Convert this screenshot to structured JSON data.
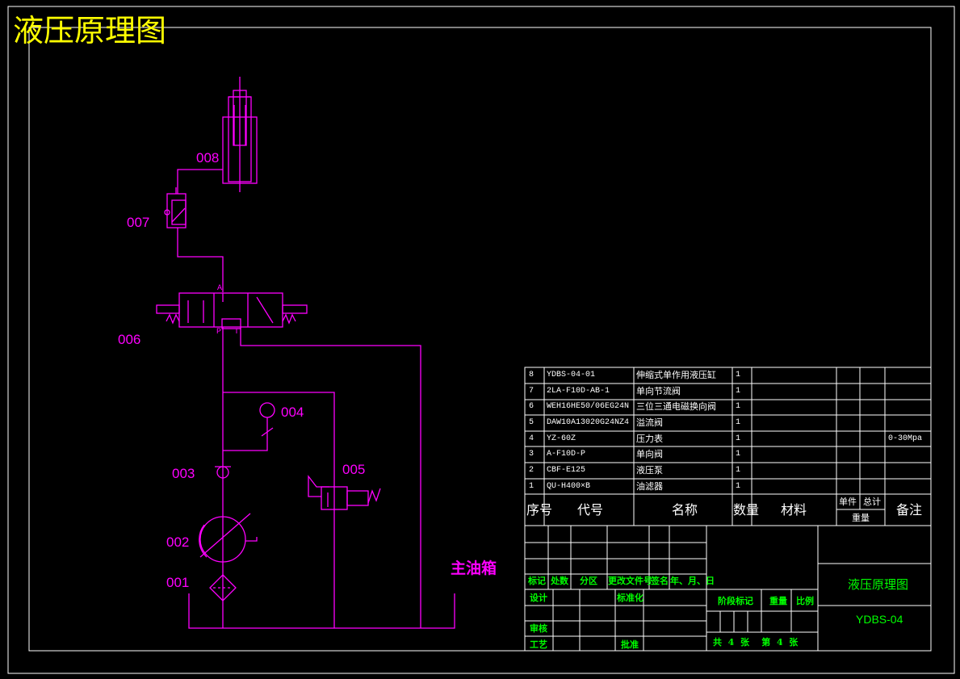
{
  "title": "液压原理图",
  "components": {
    "c001": "001",
    "c002": "002",
    "c003": "003",
    "c004": "004",
    "c005": "005",
    "c006": "006",
    "c007": "007",
    "c008": "008"
  },
  "tank_label": "主油箱",
  "valve_ports": {
    "a": "A",
    "p": "P",
    "t": "T"
  },
  "colors": {
    "frame": "#ffffff",
    "circuit": "#ff00ff",
    "title": "#ffff00",
    "titleblock_text": "#00ff00"
  },
  "parts_list": {
    "rows": [
      {
        "no": "8",
        "code": "YDBS-04-01",
        "name": "伸缩式单作用液压缸",
        "qty": "1",
        "note": ""
      },
      {
        "no": "7",
        "code": "2LA-F10D-AB-1",
        "name": "单向节流阀",
        "qty": "1",
        "note": ""
      },
      {
        "no": "6",
        "code": "WEH16HE50/06EG24N",
        "name": "三位三通电磁换向阀",
        "qty": "1",
        "note": ""
      },
      {
        "no": "5",
        "code": "DAW10A13020G24NZ4",
        "name": "溢流阀",
        "qty": "1",
        "note": ""
      },
      {
        "no": "4",
        "code": "YZ-60Z",
        "name": "压力表",
        "qty": "1",
        "note": "0-30Mpa"
      },
      {
        "no": "3",
        "code": "A-F10D-P",
        "name": "单向阀",
        "qty": "1",
        "note": ""
      },
      {
        "no": "2",
        "code": "CBF-E125",
        "name": "液压泵",
        "qty": "1",
        "note": ""
      },
      {
        "no": "1",
        "code": "QU-H400×B",
        "name": "油滤器",
        "qty": "1",
        "note": ""
      }
    ],
    "header": {
      "no": "序号",
      "code": "代号",
      "name": "名称",
      "qty": "数量",
      "material": "材料",
      "unit": "单件",
      "total": "总计",
      "weight": "重量",
      "note": "备注"
    }
  },
  "title_block": {
    "mark": "标记",
    "count": "处数",
    "zone": "分区",
    "change_doc": "更改文件号",
    "sign": "签名",
    "date": "年、月、日",
    "design": "设计",
    "standard": "标准化",
    "review": "审核",
    "process": "工艺",
    "approve": "批准",
    "stage": "阶段标记",
    "weight": "重量",
    "scale": "比例",
    "drawing_name": "液压原理图",
    "drawing_no": "YDBS-04",
    "sheets": "共  4  张    第  4  张"
  }
}
